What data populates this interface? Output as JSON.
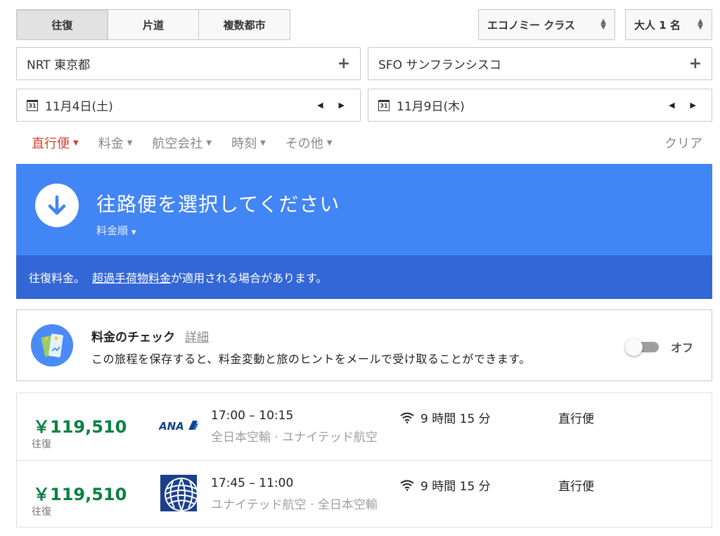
{
  "trip_type": {
    "round_trip": "往復",
    "one_way": "片道",
    "multi_city": "複数都市"
  },
  "cabin_class": "エコノミー クラス",
  "passengers": "大人 1 名",
  "origin": "NRT 東京都",
  "destination": "SFO サンフランシスコ",
  "add_symbol": "+",
  "departure_date": "11月4日(土)",
  "return_date": "11月9日(木)",
  "calendar_icon_text": "31",
  "filters": [
    {
      "label": "直行便",
      "active": true
    },
    {
      "label": "料金",
      "active": false
    },
    {
      "label": "航空会社",
      "active": false
    },
    {
      "label": "時刻",
      "active": false
    },
    {
      "label": "その他",
      "active": false
    }
  ],
  "clear_label": "クリア",
  "banner": {
    "title": "往路便を選択してください",
    "sort_label": "料金順",
    "note_prefix": "往復料金。",
    "note_link": "超過手荷物料金",
    "note_suffix": "が適用される場合があります。"
  },
  "price_tracking": {
    "title": "料金のチェック",
    "detail_link": "詳細",
    "description": "この旅程を保存すると、料金変動と旅のヒントをメールで受け取ることができます。",
    "toggle_label": "オフ",
    "toggle_on": false
  },
  "flights": [
    {
      "price": "￥119,510",
      "price_type": "往復",
      "logo_text": "ANA",
      "times": "17:00 – 10:15",
      "airlines": "全日本空輸 · ユナイテッド航空",
      "duration": "9 時間 15 分",
      "stops": "直行便"
    },
    {
      "price": "￥119,510",
      "price_type": "往復",
      "logo_text": "",
      "times": "17:45 – 11:00",
      "airlines": "ユナイテッド航空 · 全日本空輸",
      "duration": "9 時間 15 分",
      "stops": "直行便"
    }
  ],
  "colors": {
    "banner": "#4285f4",
    "banner_note": "#3367d6",
    "price": "#0b8043",
    "active_filter": "#d23f31"
  }
}
